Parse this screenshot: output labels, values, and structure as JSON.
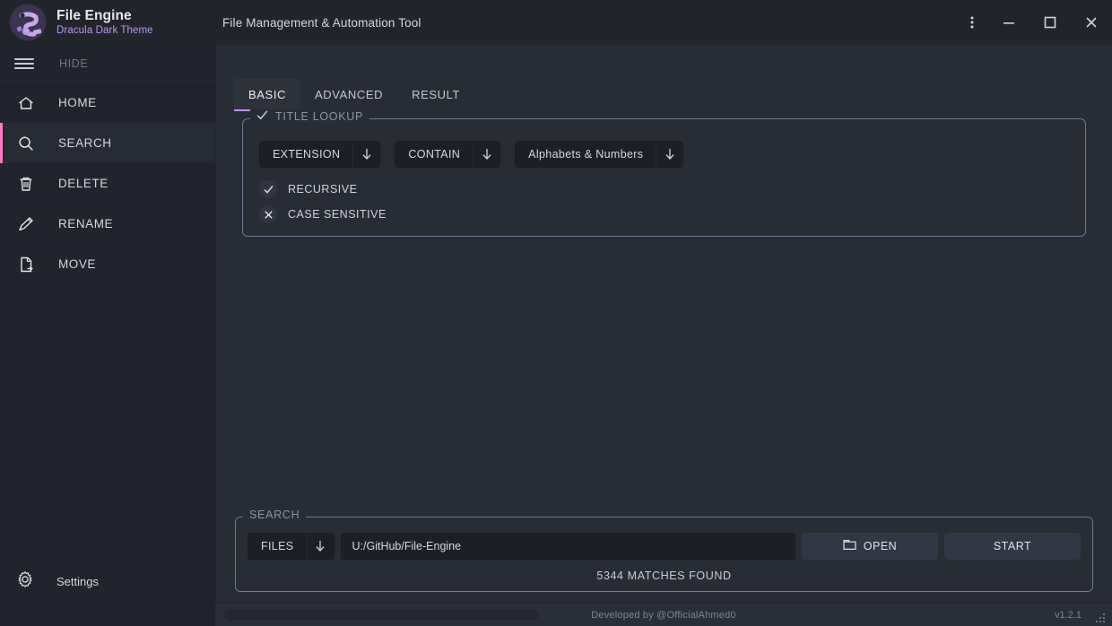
{
  "titlebar": {
    "brand_title": "File Engine",
    "brand_subtitle": "Dracula Dark Theme",
    "window_title": "File Management & Automation Tool",
    "logo_icon": "file-engine-logo-icon",
    "menu_icon": "vertical-dots-icon",
    "minimize_icon": "minimize-icon",
    "maximize_icon": "maximize-icon",
    "close_icon": "close-icon"
  },
  "sidebar": {
    "hide_label": "HIDE",
    "hamburger_icon": "hamburger-menu-icon",
    "items": [
      {
        "label": "HOME",
        "icon": "home-icon",
        "active": false
      },
      {
        "label": "SEARCH",
        "icon": "search-icon",
        "active": true
      },
      {
        "label": "DELETE",
        "icon": "trash-icon",
        "active": false
      },
      {
        "label": "RENAME",
        "icon": "pencil-icon",
        "active": false
      },
      {
        "label": "MOVE",
        "icon": "file-move-icon",
        "active": false
      }
    ],
    "settings_label": "Settings",
    "settings_icon": "gear-icon",
    "active_accent_color": "#ff79c6"
  },
  "tabs": [
    {
      "label": "BASIC",
      "active": true
    },
    {
      "label": "ADVANCED",
      "active": false
    },
    {
      "label": "RESULT",
      "active": false
    }
  ],
  "tab_accent_color": "#bd93f9",
  "basic_panel": {
    "legend": "TITLE LOOKUP",
    "legend_check_icon": "check-icon",
    "dropdowns": [
      {
        "value": "EXTENSION",
        "arrow_icon": "arrow-down-icon"
      },
      {
        "value": "CONTAIN",
        "arrow_icon": "arrow-down-icon"
      },
      {
        "value": "Alphabets & Numbers",
        "arrow_icon": "arrow-down-icon"
      }
    ],
    "toggles": [
      {
        "label": "RECURSIVE",
        "state": "on",
        "icon": "check-icon"
      },
      {
        "label": "CASE SENSITIVE",
        "state": "off",
        "icon": "cross-icon"
      }
    ]
  },
  "search_panel": {
    "legend": "SEARCH",
    "target_dropdown": {
      "value": "FILES",
      "arrow_icon": "arrow-down-icon"
    },
    "path_value": "U:/GitHub/File-Engine",
    "path_placeholder": "",
    "open_label": "OPEN",
    "open_icon": "folder-icon",
    "start_label": "START",
    "matches_text": "5344 MATCHES FOUND"
  },
  "statusbar": {
    "credit": "Developed by @OfficialAhmed0",
    "version": "v1.2.1",
    "scrollbar_name": "horizontal-scrollbar",
    "grip_icon": "resize-grip-icon"
  }
}
